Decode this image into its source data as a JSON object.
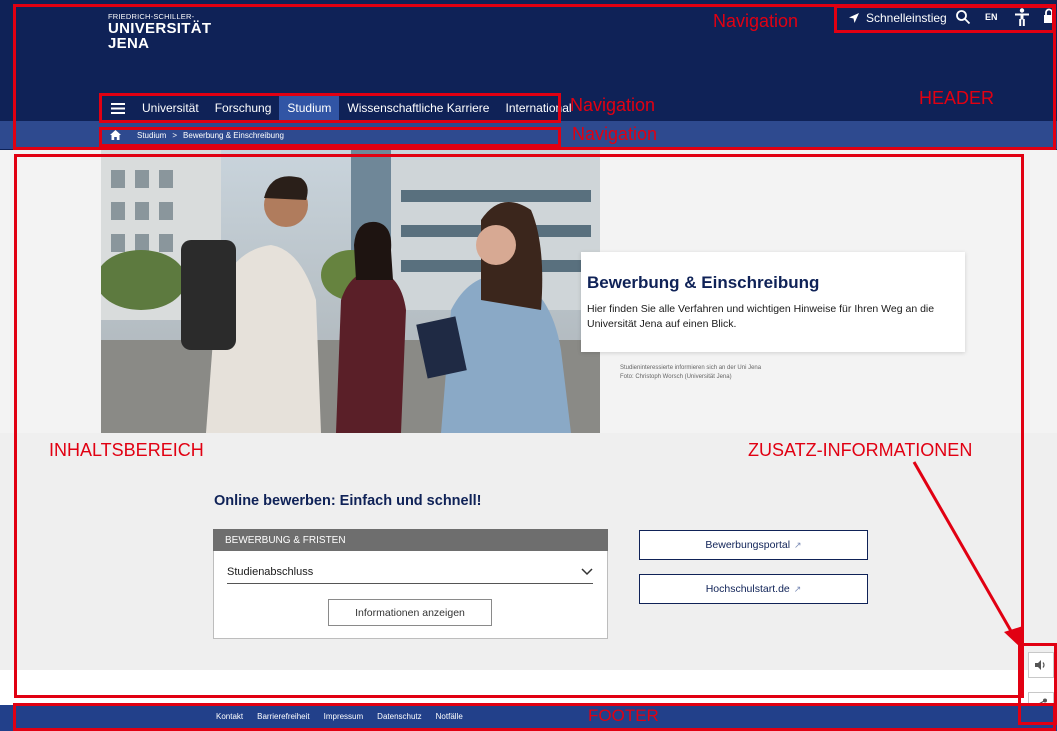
{
  "header": {
    "logo": {
      "line1": "FRIEDRICH-SCHILLER-",
      "line2": "UNIVERSITÄT",
      "line3": "JENA"
    },
    "quick_access": "Schnelleinstieg",
    "language": "EN",
    "nav": [
      "Universität",
      "Forschung",
      "Studium",
      "Wissenschaftliche Karriere",
      "International"
    ],
    "active_nav": "Studium",
    "breadcrumb": [
      "Studium",
      "Bewerbung & Einschreibung"
    ]
  },
  "hero": {
    "title": "Bewerbung & Einschreibung",
    "text": "Hier finden Sie alle Verfahren und wichtigen Hinweise für Ihren Weg an die Universität Jena auf einen Blick.",
    "caption_line1": "Studieninteressierte informieren sich an der Uni Jena",
    "caption_line2": "Foto: Christoph Worsch (Universität Jena)"
  },
  "content": {
    "title": "Online bewerben: Einfach und schnell!",
    "box_header": "BEWERBUNG & FRISTEN",
    "select_value": "Studienabschluss",
    "info_button": "Informationen anzeigen",
    "portal_buttons": [
      "Bewerbungsportal",
      "Hochschulstart.de"
    ]
  },
  "footer": {
    "links": [
      "Kontakt",
      "Barrierefreiheit",
      "Impressum",
      "Datenschutz",
      "Notfälle"
    ]
  },
  "annotations": {
    "navigation": "Navigation",
    "header": "HEADER",
    "content": "INHALTSBEREICH",
    "additional": "ZUSATZ-INFORMATIONEN",
    "footer": "FOOTER"
  },
  "colors": {
    "header_bg": "#0f2257",
    "breadcrumb_bar": "#2e4a8f",
    "annotation": "#e10012",
    "footer_bg": "#22408a"
  },
  "icons": [
    "menu-icon",
    "location-arrow-icon",
    "search-icon",
    "accessibility-icon",
    "lock-icon",
    "home-icon",
    "chevron-down-icon",
    "external-link-icon",
    "speaker-icon",
    "share-icon"
  ]
}
